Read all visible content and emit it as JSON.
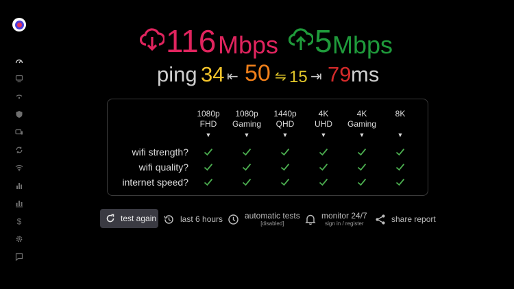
{
  "sidebar": {
    "icons": [
      "speedometer-icon",
      "monitor-icon",
      "wifi-router-icon",
      "shield-icon",
      "devices-icon",
      "sync-icon",
      "wifi-icon",
      "bar-chart-icon",
      "stacked-chart-icon",
      "dollar-icon",
      "gear-icon",
      "chat-icon"
    ]
  },
  "speeds": {
    "download_value": "116",
    "download_unit": "Mbps",
    "upload_value": "5",
    "upload_unit": "Mbps",
    "download_color": "#e0245e",
    "upload_color": "#1f9a3b"
  },
  "ping": {
    "label": "ping",
    "low": "34",
    "avg": "50",
    "jitter": "15",
    "high": "79",
    "unit": "ms",
    "arrow_left": "⇤",
    "arrow_jitter": "⇋",
    "arrow_right": "⇥"
  },
  "table": {
    "columns": [
      {
        "line1": "1080p",
        "line2": "FHD"
      },
      {
        "line1": "1080p",
        "line2": "Gaming"
      },
      {
        "line1": "1440p",
        "line2": "QHD"
      },
      {
        "line1": "4K",
        "line2": "UHD"
      },
      {
        "line1": "4K",
        "line2": "Gaming"
      },
      {
        "line1": "8K",
        "line2": ""
      }
    ],
    "sort_glyph": "▼",
    "rows": [
      {
        "label": "wifi strength?",
        "checks": [
          true,
          true,
          true,
          true,
          true,
          true
        ]
      },
      {
        "label": "wifi quality?",
        "checks": [
          true,
          true,
          true,
          true,
          true,
          true
        ]
      },
      {
        "label": "internet speed?",
        "checks": [
          true,
          true,
          true,
          true,
          true,
          true
        ]
      }
    ],
    "check_color": "#4caf50"
  },
  "actions": {
    "test_again": "test again",
    "history": "last 6 hours",
    "auto_tests": "automatic tests",
    "auto_tests_status": "[disabled]",
    "monitor": "monitor 24/7",
    "monitor_sub": "sign in / register",
    "share": "share report"
  }
}
